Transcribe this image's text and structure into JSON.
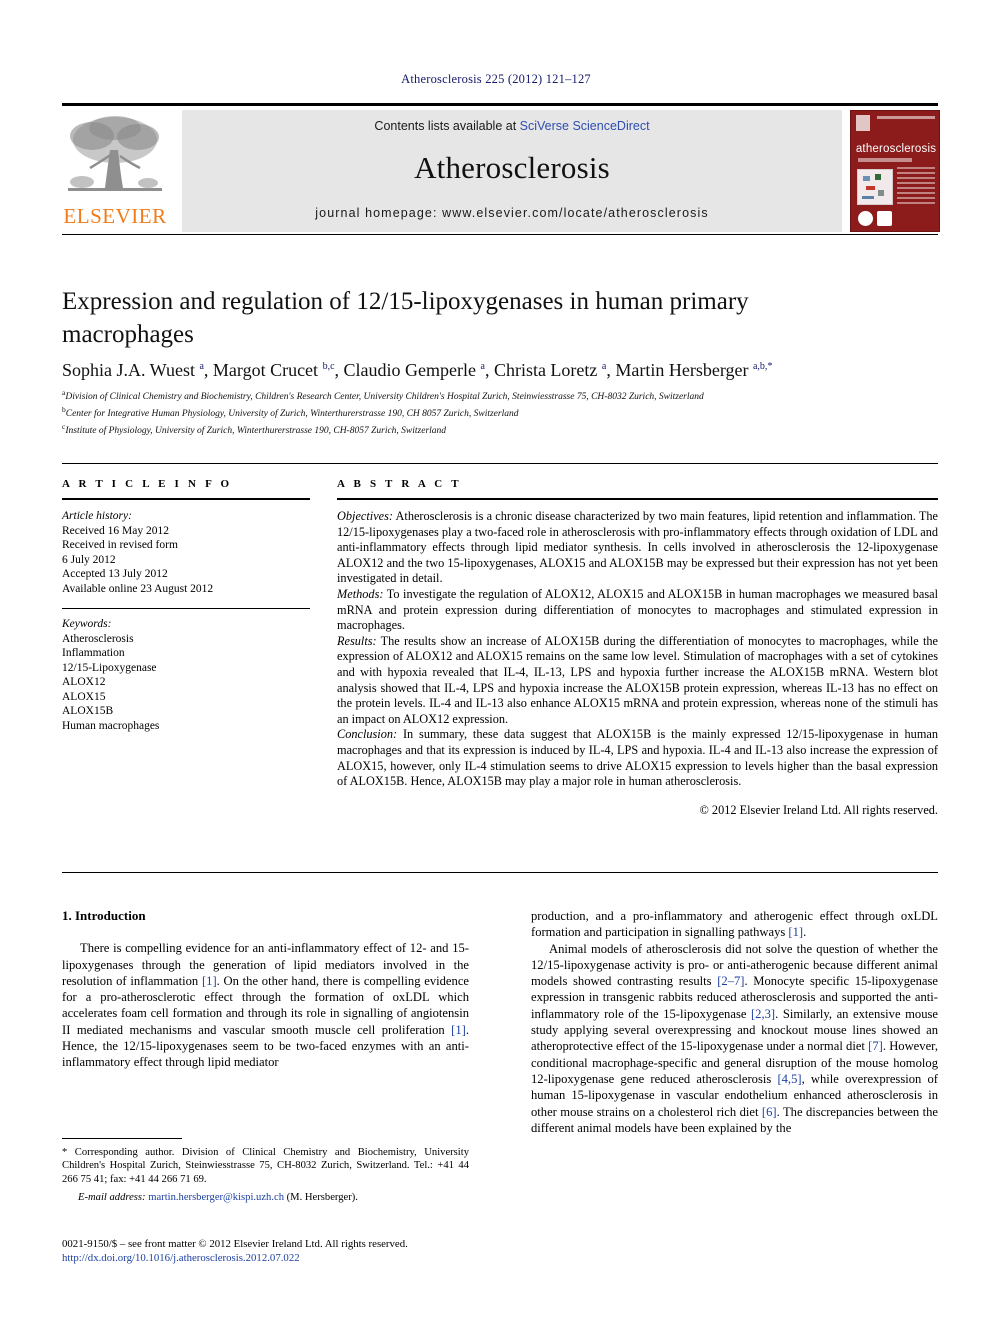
{
  "running_head": "Atherosclerosis 225 (2012) 121–127",
  "masthead": {
    "contents_prefix": "Contents lists available at ",
    "sciencedirect": "SciVerse ScienceDirect",
    "journal_title": "Atherosclerosis",
    "homepage": "journal homepage: www.elsevier.com/locate/atherosclerosis",
    "publisher": "ELSEVIER",
    "cover_title": "atherosclerosis",
    "link_color": "#2f4eb0",
    "publisher_color": "#f07c1a",
    "cover_color": "#8c1b1b"
  },
  "article": {
    "title": "Expression and regulation of 12/15-lipoxygenases in human primary macrophages",
    "authors_html": "Sophia J.A. Wuest <sup>a</sup>, Margot Crucet <sup>b,c</sup>, Claudio Gemperle <sup>a</sup>, Christa Loretz <sup>a</sup>, Martin Hersberger <sup>a,b,</sup><sup>*</sup>",
    "affiliations": [
      {
        "marker": "a",
        "text": "Division of Clinical Chemistry and Biochemistry, Children's Research Center, University Children's Hospital Zurich, Steinwiesstrasse 75, CH-8032 Zurich, Switzerland"
      },
      {
        "marker": "b",
        "text": "Center for Integrative Human Physiology, University of Zurich, Winterthurerstrasse 190, CH 8057 Zurich, Switzerland"
      },
      {
        "marker": "c",
        "text": "Institute of Physiology, University of Zurich, Winterthurerstrasse 190, CH-8057 Zurich, Switzerland"
      }
    ]
  },
  "info": {
    "heading": "A R T I C L E   I N F O",
    "history_label": "Article history:",
    "history": [
      "Received 16 May 2012",
      "Received in revised form",
      "6 July 2012",
      "Accepted 13 July 2012",
      "Available online 23 August 2012"
    ],
    "keywords_label": "Keywords:",
    "keywords": [
      "Atherosclerosis",
      "Inflammation",
      "12/15-Lipoxygenase",
      "ALOX12",
      "ALOX15",
      "ALOX15B",
      "Human macrophages"
    ]
  },
  "abstract": {
    "heading": "A B S T R A C T",
    "objectives_label": "Objectives:",
    "objectives": " Atherosclerosis is a chronic disease characterized by two main features, lipid retention and inflammation. The 12/15-lipoxygenases play a two-faced role in atherosclerosis with pro-inflammatory effects through oxidation of LDL and anti-inflammatory effects through lipid mediator synthesis. In cells involved in atherosclerosis the 12-lipoxygenase ALOX12 and the two 15-lipoxygenases, ALOX15 and ALOX15B may be expressed but their expression has not yet been investigated in detail.",
    "methods_label": "Methods:",
    "methods": " To investigate the regulation of ALOX12, ALOX15 and ALOX15B in human macrophages we measured basal mRNA and protein expression during differentiation of monocytes to macrophages and stimulated expression in macrophages.",
    "results_label": "Results:",
    "results": " The results show an increase of ALOX15B during the differentiation of monocytes to macrophages, while the expression of ALOX12 and ALOX15 remains on the same low level. Stimulation of macrophages with a set of cytokines and with hypoxia revealed that IL-4, IL-13, LPS and hypoxia further increase the ALOX15B mRNA. Western blot analysis showed that IL-4, LPS and hypoxia increase the ALOX15B protein expression, whereas IL-13 has no effect on the protein levels. IL-4 and IL-13 also enhance ALOX15 mRNA and protein expression, whereas none of the stimuli has an impact on ALOX12 expression.",
    "conclusion_label": "Conclusion:",
    "conclusion": " In summary, these data suggest that ALOX15B is the mainly expressed 12/15-lipoxygenase in human macrophages and that its expression is induced by IL-4, LPS and hypoxia. IL-4 and IL-13 also increase the expression of ALOX15, however, only IL-4 stimulation seems to drive ALOX15 expression to levels higher than the basal expression of ALOX15B. Hence, ALOX15B may play a major role in human atherosclerosis.",
    "copyright": "© 2012 Elsevier Ireland Ltd. All rights reserved."
  },
  "intro": {
    "heading": "1. Introduction",
    "left_html": "There is compelling evidence for an anti-inflammatory effect of 12- and 15-lipoxygenases through the generation of lipid mediators involved in the resolution of inflammation <span class=\"ref\">[1]</span>. On the other hand, there is compelling evidence for a pro-atherosclerotic effect through the formation of oxLDL which accelerates foam cell formation and through its role in signalling of angiotensin II mediated mechanisms and vascular smooth muscle cell proliferation <span class=\"ref\">[1]</span>. Hence, the 12/15-lipoxygenases seem to be two-faced enzymes with an anti-inflammatory effect through lipid mediator",
    "right_first_html": "production, and a pro-inflammatory and atherogenic effect through oxLDL formation and participation in signalling pathways <span class=\"ref\">[1]</span>.",
    "right_second_html": "Animal models of atherosclerosis did not solve the question of whether the 12/15-lipoxygenase activity is pro- or anti-atherogenic because different animal models showed contrasting results <span class=\"ref\">[2&ndash;7]</span>. Monocyte specific 15-lipoxygenase expression in transgenic rabbits reduced atherosclerosis and supported the anti-inflammatory role of the 15-lipoxygenase <span class=\"ref\">[2,3]</span>. Similarly, an extensive mouse study applying several overexpressing and knockout mouse lines showed an atheroprotective effect of the 15-lipoxygenase under a normal diet <span class=\"ref\">[7]</span>. However, conditional macrophage-specific and general disruption of the mouse homolog 12-lipoxygenase gene reduced atherosclerosis <span class=\"ref\">[4,5]</span>, while overexpression of human 15-lipoxygenase in vascular endothelium enhanced atherosclerosis in other mouse strains on a cholesterol rich diet <span class=\"ref\">[6]</span>. The discrepancies between the different animal models have been explained by the"
  },
  "footnote": {
    "text": "* Corresponding author. Division of Clinical Chemistry and Biochemistry, University Children's Hospital Zurich, Steinwiesstrasse 75, CH-8032 Zurich, Switzerland. Tel.: +41 44 266 75 41; fax: +41 44 266 71 69.",
    "email_label": "E-mail address:",
    "email": "martin.hersberger@kispi.uzh.ch",
    "email_suffix": " (M. Hersberger)."
  },
  "imprint": {
    "line1": "0021-9150/$ – see front matter © 2012 Elsevier Ireland Ltd. All rights reserved.",
    "doi": "http://dx.doi.org/10.1016/j.atherosclerosis.2012.07.022"
  }
}
